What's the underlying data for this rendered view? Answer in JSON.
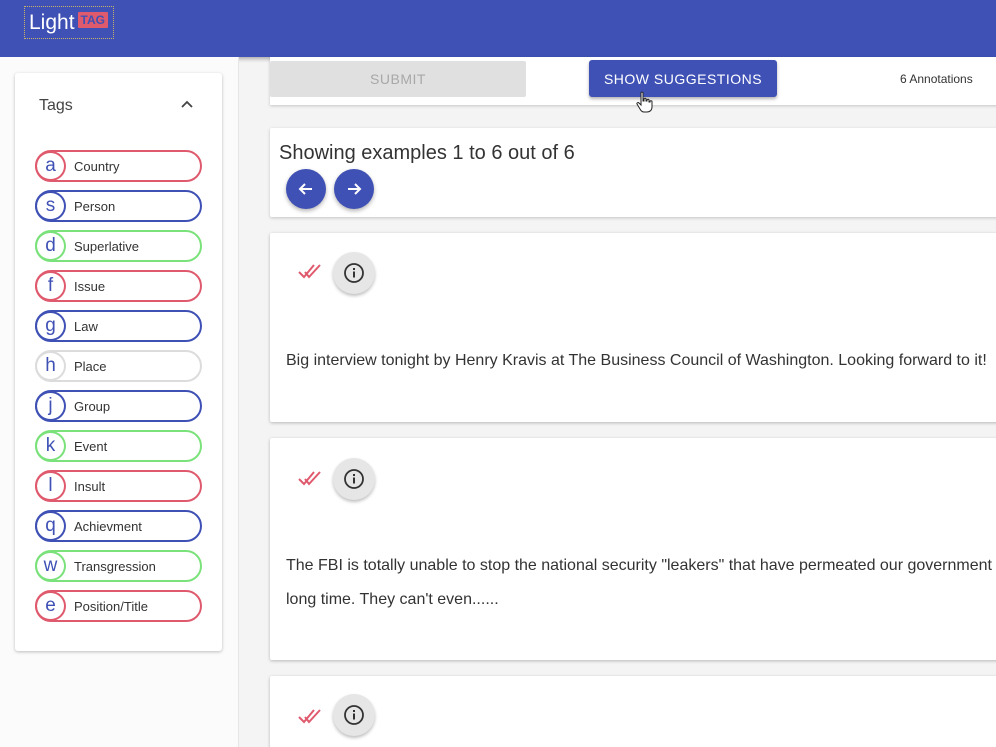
{
  "header": {
    "logo_text": "Light",
    "logo_badge": "TAG",
    "bar_color": "#3f51b5"
  },
  "tags_panel": {
    "title": "Tags",
    "collapse_icon": "chevron-up-icon",
    "items": [
      {
        "key": "a",
        "label": "Country",
        "color": "#e05a6e"
      },
      {
        "key": "s",
        "label": "Person",
        "color": "#3f51b5"
      },
      {
        "key": "d",
        "label": "Superlative",
        "color": "#7be27b"
      },
      {
        "key": "f",
        "label": "Issue",
        "color": "#e05a6e"
      },
      {
        "key": "g",
        "label": "Law",
        "color": "#3f51b5"
      },
      {
        "key": "h",
        "label": "Place",
        "color": "#dcdcdc"
      },
      {
        "key": "j",
        "label": "Group",
        "color": "#3f51b5"
      },
      {
        "key": "k",
        "label": "Event",
        "color": "#7be27b"
      },
      {
        "key": "l",
        "label": "Insult",
        "color": "#e05a6e"
      },
      {
        "key": "q",
        "label": "Achievment",
        "color": "#3f51b5"
      },
      {
        "key": "w",
        "label": "Transgression",
        "color": "#7be27b"
      },
      {
        "key": "e",
        "label": "Position/Title",
        "color": "#e05a6e"
      }
    ]
  },
  "toolbar": {
    "submit_label": "SUBMIT",
    "suggestions_label": "SHOW SUGGESTIONS",
    "annotations_count": "6 Annotations"
  },
  "paging": {
    "text": "Showing examples 1 to 6 out of 6",
    "prev_icon": "arrow-left-icon",
    "next_icon": "arrow-right-icon"
  },
  "examples": [
    {
      "lines": [
        "Big interview tonight by Henry Kravis at The Business Council of Washington. Looking forward to it!"
      ]
    },
    {
      "lines": [
        "The FBI is totally unable to stop the national security \"leakers\" that have permeated our government for a",
        "long time. They can't even......"
      ]
    },
    {
      "lines": []
    }
  ],
  "colors": {
    "primary": "#3f51b5",
    "check": "#e05a6e"
  }
}
